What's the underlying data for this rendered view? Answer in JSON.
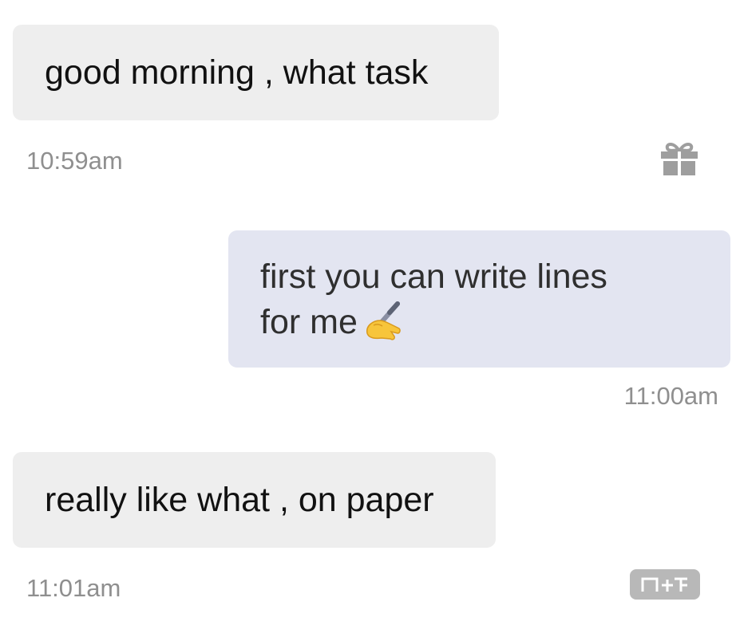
{
  "messages": [
    {
      "direction": "incoming",
      "text": "good morning , what task",
      "time": "10:59am"
    },
    {
      "direction": "outgoing",
      "text": "first you can write lines\nfor me",
      "emoji": "writing-hand",
      "time": "11:00am"
    },
    {
      "direction": "incoming",
      "text": "really like what , on paper",
      "time": "11:01am"
    }
  ],
  "icons": {
    "gift": "gift-icon",
    "badge": "nf-logo-icon"
  },
  "colors": {
    "incoming_bubble": "#eeeeee",
    "outgoing_bubble": "#e3e5f1",
    "timestamp": "#8f8f8f",
    "icon_gray": "#9e9e9e"
  }
}
